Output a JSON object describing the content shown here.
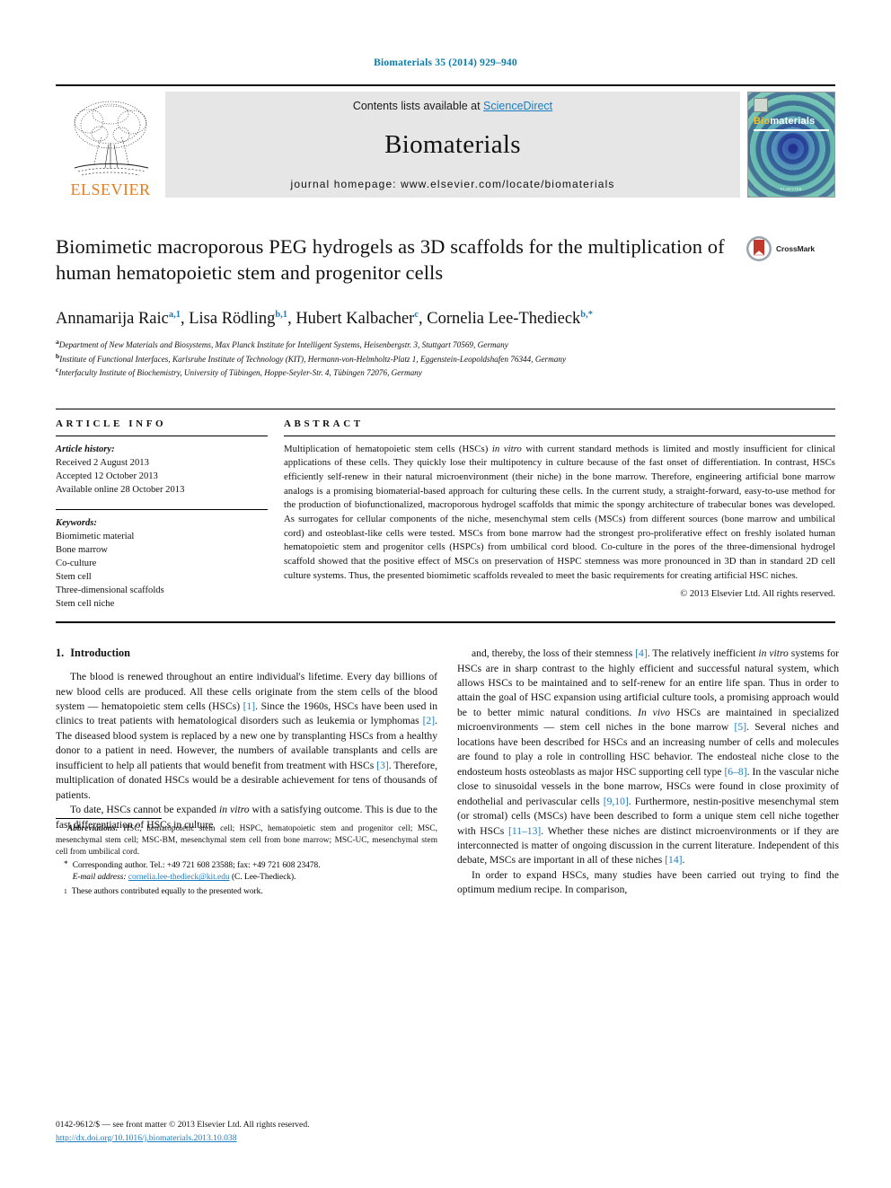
{
  "running_head": "Biomaterials 35 (2014) 929–940",
  "masthead": {
    "contents_prefix": "Contents lists available at ",
    "sciencedirect": "ScienceDirect",
    "journal_name": "Biomaterials",
    "homepage": "journal homepage: www.elsevier.com/locate/biomaterials",
    "publisher_logo_text": "ELSEVIER",
    "cover": {
      "title_first": "Bio",
      "title_rest": "materials",
      "footer": "ELSEVIER"
    }
  },
  "article": {
    "title": "Biomimetic macroporous PEG hydrogels as 3D scaffolds for the multiplication of human hematopoietic stem and progenitor cells",
    "crossmark_label": "CrossMark",
    "authors": [
      {
        "name": "Annamarija Raic",
        "marks": "a,1",
        "sep": ", "
      },
      {
        "name": "Lisa Rödling",
        "marks": "b,1",
        "sep": ", "
      },
      {
        "name": "Hubert Kalbacher",
        "marks": "c",
        "sep": ", "
      },
      {
        "name": "Cornelia Lee-Thedieck",
        "marks": "b,*",
        "sep": ""
      }
    ],
    "affiliations": [
      {
        "mark": "a",
        "text": "Department of New Materials and Biosystems, Max Planck Institute for Intelligent Systems, Heisenbergstr. 3, Stuttgart 70569, Germany"
      },
      {
        "mark": "b",
        "text": "Institute of Functional Interfaces, Karlsruhe Institute of Technology (KIT), Hermann-von-Helmholtz-Platz 1, Eggenstein-Leopoldshafen 76344, Germany"
      },
      {
        "mark": "c",
        "text": "Interfaculty Institute of Biochemistry, University of Tübingen, Hoppe-Seyler-Str. 4, Tübingen 72076, Germany"
      }
    ]
  },
  "article_info": {
    "heading": "ARTICLE INFO",
    "history_label": "Article history:",
    "history": [
      "Received 2 August 2013",
      "Accepted 12 October 2013",
      "Available online 28 October 2013"
    ],
    "keywords_label": "Keywords:",
    "keywords": [
      "Biomimetic material",
      "Bone marrow",
      "Co-culture",
      "Stem cell",
      "Three-dimensional scaffolds",
      "Stem cell niche"
    ]
  },
  "abstract": {
    "heading": "ABSTRACT",
    "text_part1": "Multiplication of hematopoietic stem cells (HSCs) ",
    "italic1": "in vitro",
    "text_part2": " with current standard methods is limited and mostly insufficient for clinical applications of these cells. They quickly lose their multipotency in culture because of the fast onset of differentiation. In contrast, HSCs efficiently self-renew in their natural microenvironment (their niche) in the bone marrow. Therefore, engineering artificial bone marrow analogs is a promising biomaterial-based approach for culturing these cells. In the current study, a straight-forward, easy-to-use method for the production of biofunctionalized, macroporous hydrogel scaffolds that mimic the spongy architecture of trabecular bones was developed. As surrogates for cellular components of the niche, mesenchymal stem cells (MSCs) from different sources (bone marrow and umbilical cord) and osteoblast-like cells were tested. MSCs from bone marrow had the strongest pro-proliferative effect on freshly isolated human hematopoietic stem and progenitor cells (HSPCs) from umbilical cord blood. Co-culture in the pores of the three-dimensional hydrogel scaffold showed that the positive effect of MSCs on preservation of HSPC stemness was more pronounced in 3D than in standard 2D cell culture systems. Thus, the presented biomimetic scaffolds revealed to meet the basic requirements for creating artificial HSC niches.",
    "copyright": "© 2013 Elsevier Ltd. All rights reserved."
  },
  "introduction": {
    "number": "1.",
    "heading": "Introduction",
    "left_paragraphs": [
      {
        "segments": [
          {
            "t": "The blood is renewed throughout an entire individual's lifetime. Every day billions of new blood cells are produced. All these cells originate from the stem cells of the blood system — hematopoietic stem cells (HSCs) "
          },
          {
            "t": "[1]",
            "style": "ref"
          },
          {
            "t": ". Since the 1960s, HSCs have been used in clinics to treat patients with hematological disorders such as leukemia or lymphomas "
          },
          {
            "t": "[2]",
            "style": "ref"
          },
          {
            "t": ". The diseased blood system is replaced by a new one by transplanting HSCs from a healthy donor to a patient in need. However, the numbers of available transplants and cells are insufficient to help all patients that would benefit from treatment with HSCs "
          },
          {
            "t": "[3]",
            "style": "ref"
          },
          {
            "t": ". Therefore, multiplication of donated HSCs would be a desirable achievement for tens of thousands of patients."
          }
        ]
      },
      {
        "segments": [
          {
            "t": "To date, HSCs cannot be expanded "
          },
          {
            "t": "in vitro",
            "style": "it"
          },
          {
            "t": " with a satisfying outcome. This is due to the fast differentiation of HSCs in culture"
          }
        ]
      }
    ],
    "right_paragraphs": [
      {
        "segments": [
          {
            "t": "and, thereby, the loss of their stemness "
          },
          {
            "t": "[4]",
            "style": "ref"
          },
          {
            "t": ". The relatively inefficient "
          },
          {
            "t": "in vitro",
            "style": "it"
          },
          {
            "t": " systems for HSCs are in sharp contrast to the highly efficient and successful natural system, which allows HSCs to be maintained and to self-renew for an entire life span. Thus in order to attain the goal of HSC expansion using artificial culture tools, a promising approach would be to better mimic natural conditions. "
          },
          {
            "t": "In vivo",
            "style": "it"
          },
          {
            "t": " HSCs are maintained in specialized microenvironments — stem cell niches in the bone marrow "
          },
          {
            "t": "[5]",
            "style": "ref"
          },
          {
            "t": ". Several niches and locations have been described for HSCs and an increasing number of cells and molecules are found to play a role in controlling HSC behavior. The endosteal niche close to the endosteum hosts osteoblasts as major HSC supporting cell type "
          },
          {
            "t": "[6–8]",
            "style": "ref"
          },
          {
            "t": ". In the vascular niche close to sinusoidal vessels in the bone marrow, HSCs were found in close proximity of endothelial and perivascular cells "
          },
          {
            "t": "[9,10]",
            "style": "ref"
          },
          {
            "t": ". Furthermore, nestin-positive mesenchymal stem (or stromal) cells (MSCs) have been described to form a unique stem cell niche together with HSCs "
          },
          {
            "t": "[11–13]",
            "style": "ref"
          },
          {
            "t": ". Whether these niches are distinct microenvironments or if they are interconnected is matter of ongoing discussion in the current literature. Independent of this debate, MSCs are important in all of these niches "
          },
          {
            "t": "[14]",
            "style": "ref"
          },
          {
            "t": "."
          }
        ]
      },
      {
        "segments": [
          {
            "t": "In order to expand HSCs, many studies have been carried out trying to find the optimum medium recipe. In comparison,"
          }
        ]
      }
    ]
  },
  "footnotes": {
    "abbreviations_label": "Abbreviations:",
    "abbreviations_text": " HSC, hematopoietic stem cell; HSPC, hematopoietic stem and progenitor cell; MSC, mesenchymal stem cell; MSC-BM, mesenchymal stem cell from bone marrow; MSC-UC, mesenchymal stem cell from umbilical cord.",
    "corresponding_mark": "*",
    "corresponding_text": "Corresponding author. Tel.: +49 721 608 23588; fax: +49 721 608 23478.",
    "email_label": "E-mail address:",
    "email": "cornelia.lee-thedieck@kit.edu",
    "email_suffix": " (C. Lee-Thedieck).",
    "equal_mark": "1",
    "equal_text": "These authors contributed equally to the presented work."
  },
  "imprint": {
    "line1": "0142-9612/$ — see front matter © 2013 Elsevier Ltd. All rights reserved.",
    "doi": "http://dx.doi.org/10.1016/j.biomaterials.2013.10.038"
  },
  "colors": {
    "link_blue": "#1a7dc0",
    "running_head_blue": "#0b7ba8",
    "elsevier_orange": "#E87B1E",
    "masthead_grey": "#e6e6e6"
  }
}
